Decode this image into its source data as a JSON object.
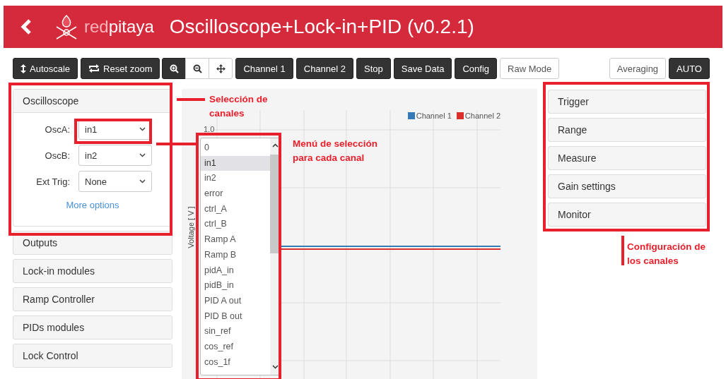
{
  "header": {
    "brand": {
      "accent": "red",
      "rest": "pitaya"
    },
    "title": "Oscilloscope+Lock-in+PID (v0.2.1)"
  },
  "toolbar": {
    "autoscale": "Autoscale",
    "reset_zoom": "Reset zoom",
    "zoom_tools": [
      {
        "selected": true
      },
      {
        "selected": false
      },
      {
        "selected": false
      }
    ],
    "buttons": [
      {
        "label": "Channel 1",
        "kind": "dark"
      },
      {
        "label": "Channel 2",
        "kind": "dark"
      },
      {
        "label": "Stop",
        "kind": "dark"
      },
      {
        "label": "Save Data",
        "kind": "dark"
      },
      {
        "label": "Config",
        "kind": "dark"
      },
      {
        "label": "Raw Mode",
        "kind": "light"
      }
    ],
    "right_buttons": [
      {
        "label": "Averaging",
        "kind": "light"
      },
      {
        "label": "AUTO",
        "kind": "dark"
      }
    ]
  },
  "left_panel": {
    "open_section": {
      "title": "Oscilloscope",
      "fields": [
        {
          "label": "OscA:",
          "value": "in1"
        },
        {
          "label": "OscB:",
          "value": "in2"
        },
        {
          "label": "Ext Trig:",
          "value": "None"
        }
      ],
      "link": "More options"
    },
    "sections": [
      "Outputs",
      "Lock-in modules",
      "Ramp Controller",
      "PIDs modules",
      "Lock Control"
    ]
  },
  "chart": {
    "legend": [
      {
        "name": "Channel 1",
        "color": "#337ab7"
      },
      {
        "name": "Channel 2",
        "color": "#d9302c"
      }
    ],
    "ytick": "1.0",
    "ylabel": "Voltage [ V ]"
  },
  "dropdown": {
    "options": [
      {
        "label": "0",
        "selected": false
      },
      {
        "label": "in1",
        "selected": true
      },
      {
        "label": "in2",
        "selected": false
      },
      {
        "label": "error",
        "selected": false
      },
      {
        "label": "ctrl_A",
        "selected": false
      },
      {
        "label": "ctrl_B",
        "selected": false
      },
      {
        "label": "Ramp A",
        "selected": false
      },
      {
        "label": "Ramp B",
        "selected": false
      },
      {
        "label": "pidA_in",
        "selected": false
      },
      {
        "label": "pidB_in",
        "selected": false
      },
      {
        "label": "PID A out",
        "selected": false
      },
      {
        "label": "PID B out",
        "selected": false
      },
      {
        "label": "sin_ref",
        "selected": false
      },
      {
        "label": "cos_ref",
        "selected": false
      },
      {
        "label": "cos_1f",
        "selected": false
      }
    ]
  },
  "right_panel": {
    "sections": [
      "Trigger",
      "Range",
      "Measure",
      "Gain settings",
      "Monitor"
    ]
  },
  "annotations": [
    {
      "lines": [
        "Selección de",
        "canales"
      ]
    },
    {
      "lines": [
        "Menú de selección",
        "para cada canal"
      ]
    },
    {
      "lines": [
        "Configuración de",
        "los canales"
      ]
    }
  ]
}
